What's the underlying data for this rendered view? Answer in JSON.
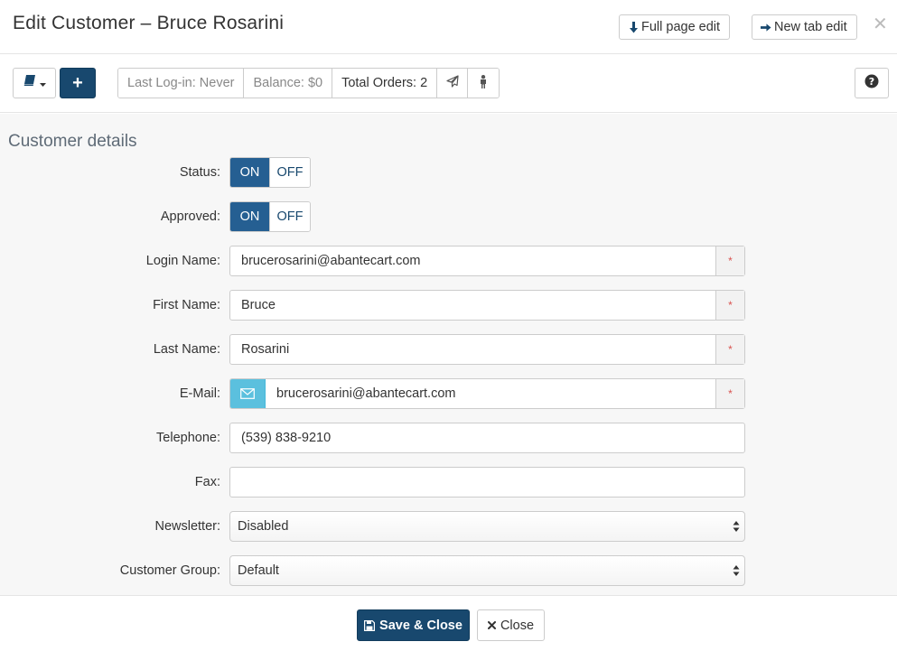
{
  "header": {
    "title": "Edit Customer – Bruce Rosarini",
    "full_page_edit_label": "Full page edit",
    "new_tab_edit_label": "New tab edit",
    "close_glyph": "✕"
  },
  "toolbar": {
    "plus_label": "+",
    "last_login": "Last Log-in: Never",
    "balance": "Balance: $0",
    "total_orders": "Total Orders: 2",
    "help_glyph": "?"
  },
  "form": {
    "section_title": "Customer details",
    "status": {
      "label": "Status:",
      "on": "ON",
      "off": "OFF",
      "value": "ON"
    },
    "approved": {
      "label": "Approved:",
      "on": "ON",
      "off": "OFF",
      "value": "ON"
    },
    "login_name": {
      "label": "Login Name:",
      "value": "brucerosarini@abantecart.com",
      "required_mark": "*"
    },
    "first_name": {
      "label": "First Name:",
      "value": "Bruce",
      "required_mark": "*"
    },
    "last_name": {
      "label": "Last Name:",
      "value": "Rosarini",
      "required_mark": "*"
    },
    "email": {
      "label": "E-Mail:",
      "value": "brucerosarini@abantecart.com",
      "required_mark": "*"
    },
    "telephone": {
      "label": "Telephone:",
      "value": "(539) 838-9210"
    },
    "fax": {
      "label": "Fax:",
      "value": ""
    },
    "newsletter": {
      "label": "Newsletter:",
      "value": "Disabled"
    },
    "customer_group": {
      "label": "Customer Group:",
      "value": "Default"
    }
  },
  "footer": {
    "save_label": "Save & Close",
    "close_label": "Close"
  },
  "colors": {
    "primary": "#18486e",
    "toggle_on": "#255f92",
    "info_addon": "#5bc0de",
    "required_star": "#d9534f"
  },
  "icons": {
    "full_page_edit": "arrow-down-icon",
    "new_tab_edit": "arrow-right-icon",
    "book": "book-icon",
    "send": "paper-plane-icon",
    "user": "user-icon",
    "help": "question-circle-icon",
    "email": "envelope-icon",
    "save": "floppy-disk-icon",
    "close": "times-icon"
  }
}
